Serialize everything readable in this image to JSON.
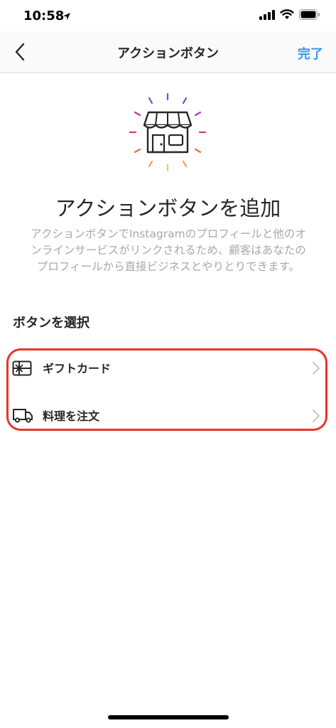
{
  "status_bar": {
    "time": "10:58"
  },
  "header": {
    "title": "アクションボタン",
    "done_label": "完了"
  },
  "intro": {
    "headline": "アクションボタンを追加",
    "description": "アクションボタンでInstagramのプロフィールと他のオンラインサービスがリンクされるため、顧客はあなたのプロフィールから直接ビジネスとやりとりできます。"
  },
  "section": {
    "title": "ボタンを選択"
  },
  "options": [
    {
      "label": "ギフトカード",
      "icon": "gift-card-icon"
    },
    {
      "label": "料理を注文",
      "icon": "delivery-truck-icon"
    }
  ],
  "colors": {
    "accent": "#3897f0",
    "highlight": "#e8352b",
    "text": "#262626",
    "secondary_text": "#a8a8a8"
  }
}
